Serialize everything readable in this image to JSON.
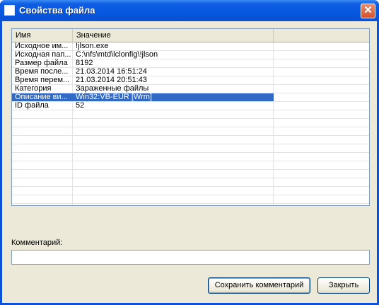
{
  "window": {
    "title": "Свойства файла",
    "close_glyph": "✕"
  },
  "list": {
    "columns": [
      "Имя",
      "Значение",
      ""
    ],
    "rows": [
      {
        "name": "Исходное им...",
        "value": "!jlson.exe"
      },
      {
        "name": "Исходная пап...",
        "value": "C:\\nfs\\mtd\\lclonfig\\!jlson"
      },
      {
        "name": "Размер файла",
        "value": "8192"
      },
      {
        "name": "Время после...",
        "value": "21.03.2014 16:51:24"
      },
      {
        "name": "Время перем...",
        "value": "21.03.2014 20:51:43"
      },
      {
        "name": "Категория",
        "value": "Зараженные файлы"
      },
      {
        "name": "Описание ви...",
        "value": "Win32:VB-EUR [Wrm]"
      },
      {
        "name": "ID файла",
        "value": "52"
      }
    ],
    "selected_index": 6,
    "empty_rows": 11
  },
  "comment": {
    "label": "Комментарий:",
    "value": ""
  },
  "buttons": {
    "save": "Сохранить комментарий",
    "close": "Закрыть"
  }
}
